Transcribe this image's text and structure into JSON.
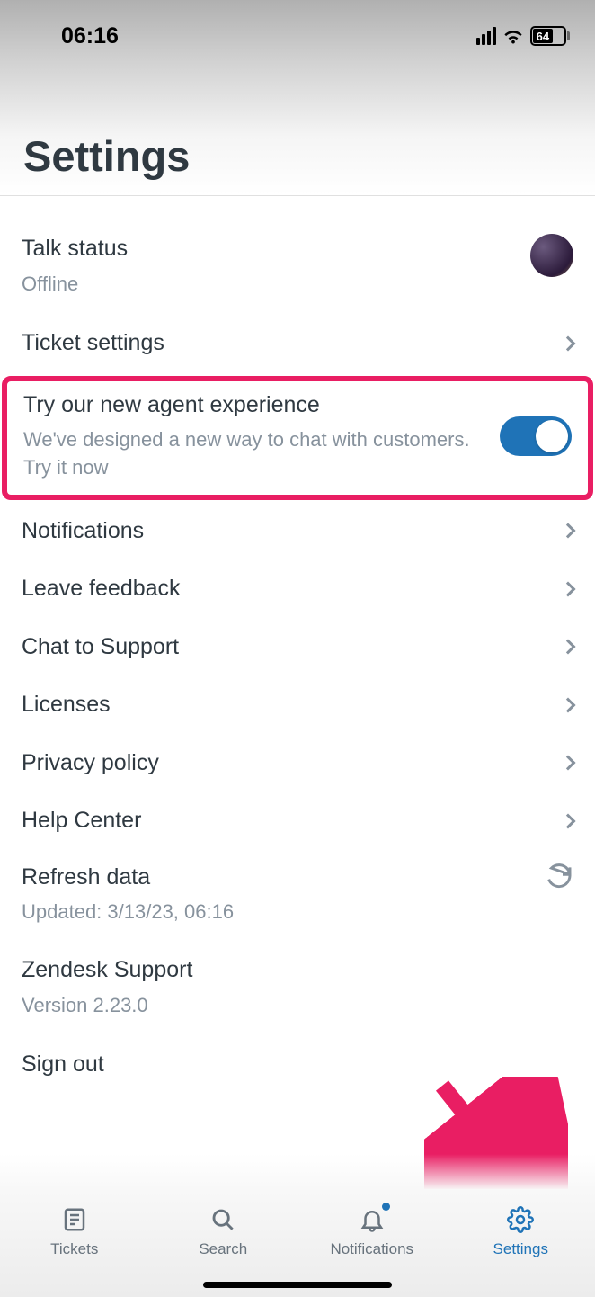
{
  "status_bar": {
    "time": "06:16",
    "battery": "64"
  },
  "header": {
    "title": "Settings"
  },
  "settings": {
    "talk_status": {
      "title": "Talk status",
      "value": "Offline"
    },
    "ticket_settings": {
      "title": "Ticket settings"
    },
    "agent_experience": {
      "title": "Try our new agent experience",
      "sub": "We've designed a new way to chat with customers. Try it now"
    },
    "notifications": {
      "title": "Notifications"
    },
    "leave_feedback": {
      "title": "Leave feedback"
    },
    "chat_support": {
      "title": "Chat to Support"
    },
    "licenses": {
      "title": "Licenses"
    },
    "privacy": {
      "title": "Privacy policy"
    },
    "help": {
      "title": "Help Center"
    },
    "refresh": {
      "title": "Refresh data",
      "sub": "Updated: 3/13/23, 06:16"
    },
    "app_info": {
      "title": "Zendesk Support",
      "sub": "Version 2.23.0"
    },
    "sign_out": {
      "title": "Sign out"
    }
  },
  "tabs": {
    "tickets": "Tickets",
    "search": "Search",
    "notifications": "Notifications",
    "settings": "Settings"
  }
}
